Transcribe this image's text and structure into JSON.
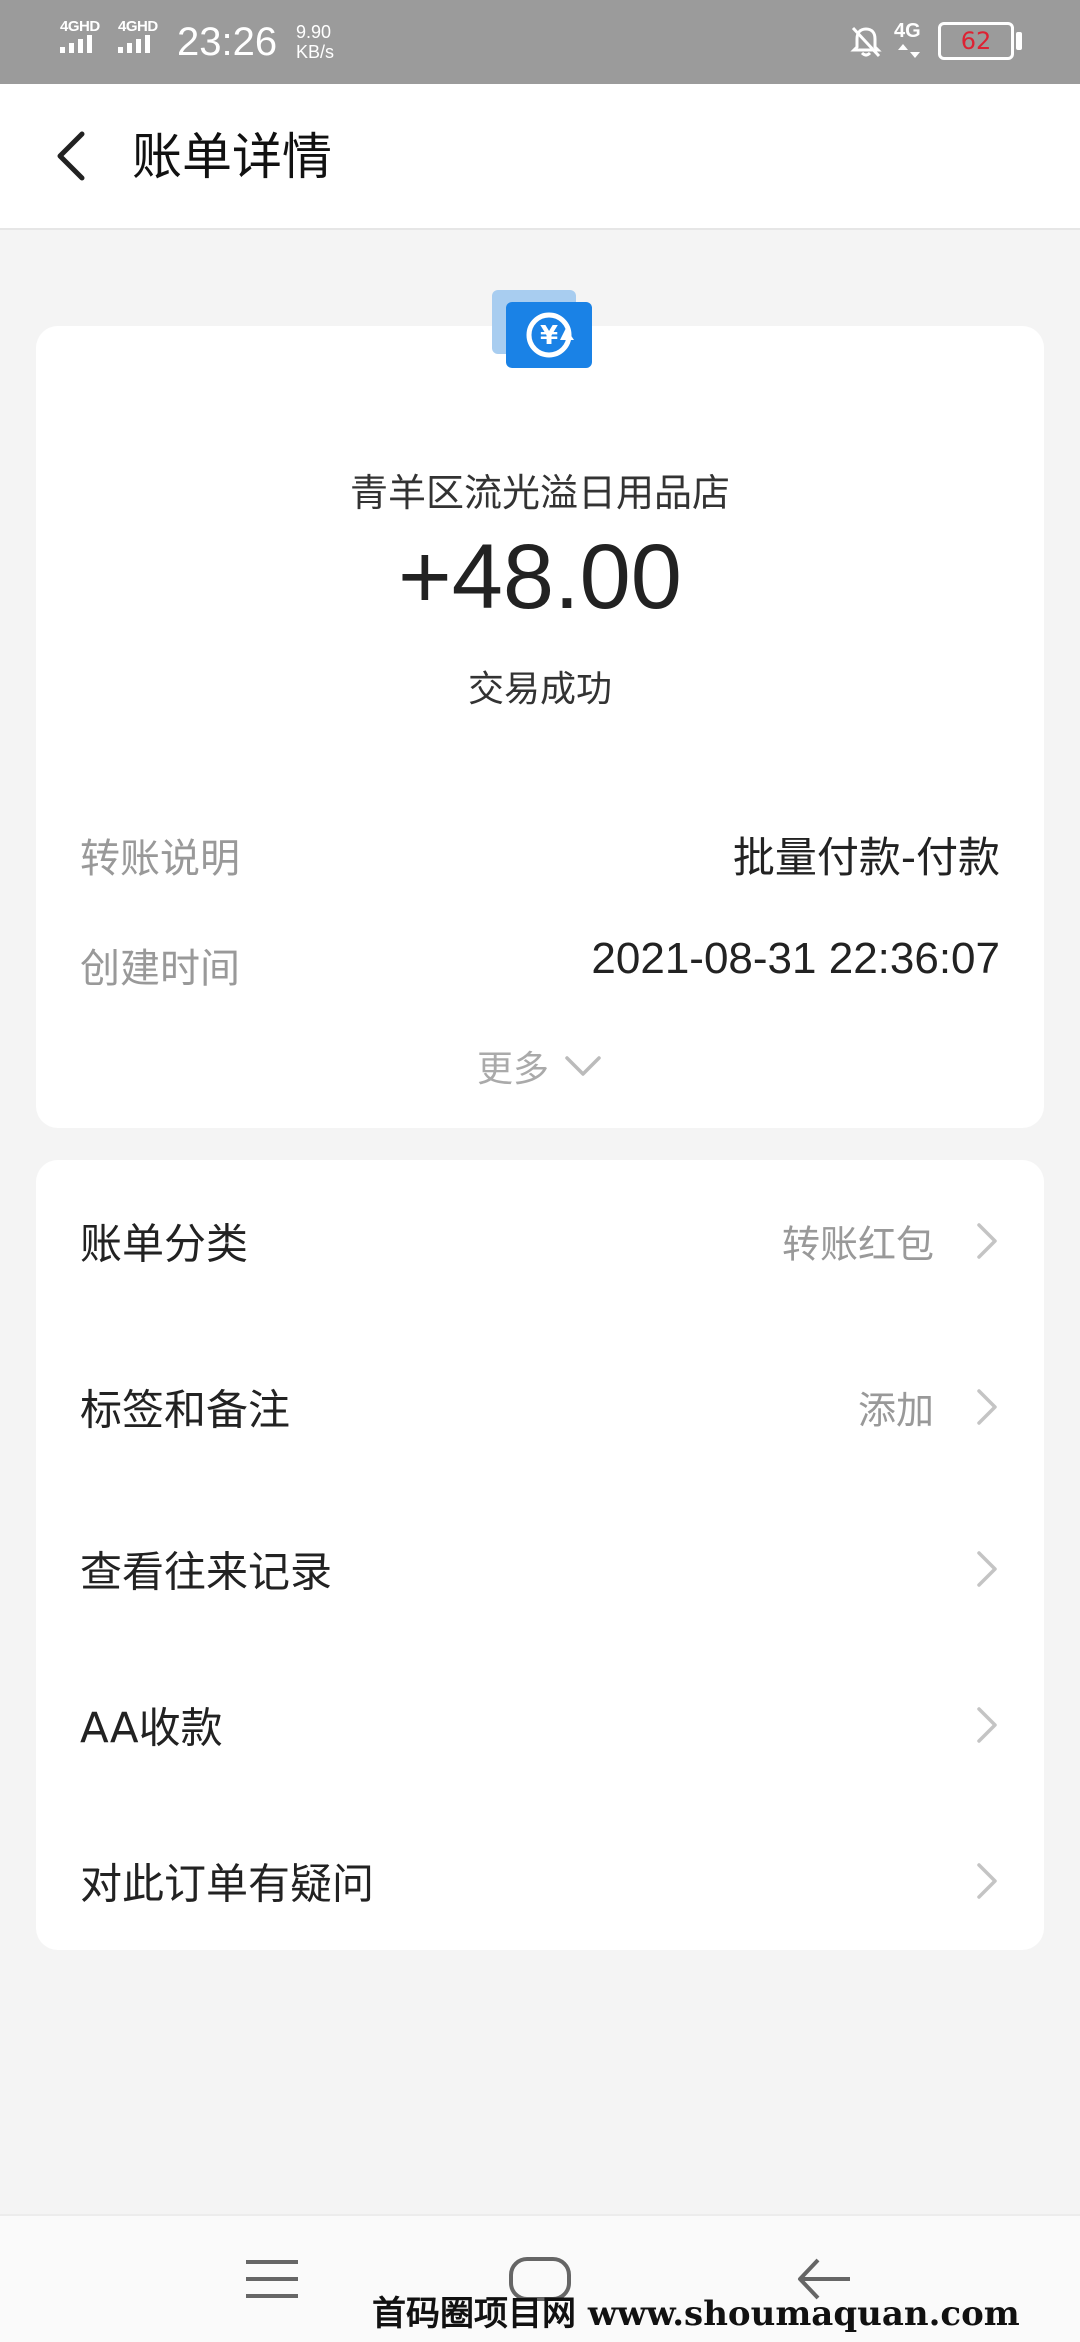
{
  "status_bar": {
    "signal1": "4GHD",
    "signal2": "4GHD",
    "time": "23:26",
    "speed_value": "9.90",
    "speed_unit": "KB/s",
    "network": "4G",
    "battery_level": "62"
  },
  "header": {
    "title": "账单详情"
  },
  "bill": {
    "merchant": "青羊区流光溢日用品店",
    "amount": "+48.00",
    "status": "交易成功",
    "details": [
      {
        "label": "转账说明",
        "value": "批量付款-付款"
      },
      {
        "label": "创建时间",
        "value": "2021-08-31 22:36:07"
      }
    ],
    "more_label": "更多"
  },
  "actions": [
    {
      "label": "账单分类",
      "value": "转账红包"
    },
    {
      "label": "标签和备注",
      "value": "添加"
    },
    {
      "label": "查看往来记录",
      "value": ""
    },
    {
      "label": "AA收款",
      "value": ""
    },
    {
      "label": "对此订单有疑问",
      "value": ""
    }
  ],
  "watermark": "首码圈项目网 www.shoumaquan.com",
  "colors": {
    "accent_blue": "#1a82e6",
    "icon_light_blue": "#a8cdf0",
    "status_bar": "#9b9b9b"
  },
  "icons": {
    "back": "chevron-left-icon",
    "merchant": "yuan-exchange-icon",
    "more": "chevron-down-icon",
    "row": "chevron-right-icon",
    "nav_menu": "menu-icon",
    "nav_home": "home-icon",
    "nav_back": "back-arrow-icon"
  }
}
